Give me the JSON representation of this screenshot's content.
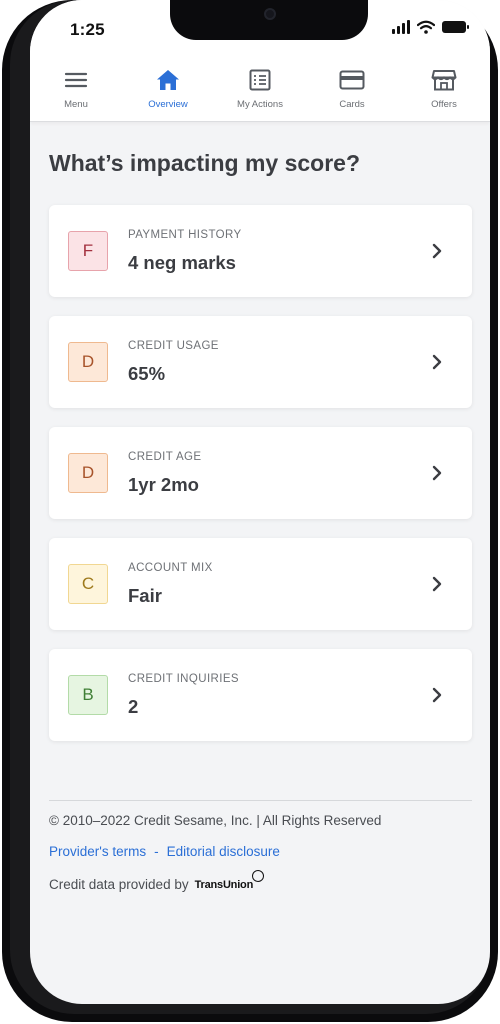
{
  "status_bar": {
    "time": "1:25"
  },
  "nav": {
    "items": [
      {
        "label": "Menu",
        "icon": "hamburger-menu-icon",
        "active": false
      },
      {
        "label": "Overview",
        "icon": "home-icon",
        "active": true
      },
      {
        "label": "My Actions",
        "icon": "checklist-icon",
        "active": false
      },
      {
        "label": "Cards",
        "icon": "credit-card-icon",
        "active": false
      },
      {
        "label": "Offers",
        "icon": "storefront-icon",
        "active": false
      }
    ],
    "active_color": "#2b6fd6"
  },
  "page": {
    "title": "What’s impacting my score?"
  },
  "factors": [
    {
      "grade": "F",
      "label": "PAYMENT HISTORY",
      "value": "4 neg marks",
      "badge_bg": "#fbe3e6",
      "badge_border": "#e7a3ab",
      "badge_color": "#a3313f"
    },
    {
      "grade": "D",
      "label": "CREDIT USAGE",
      "value": "65%",
      "badge_bg": "#fde8d8",
      "badge_border": "#efb98f",
      "badge_color": "#a7532a"
    },
    {
      "grade": "D",
      "label": "CREDIT AGE",
      "value": "1yr 2mo",
      "badge_bg": "#fde8d8",
      "badge_border": "#efb98f",
      "badge_color": "#a7532a"
    },
    {
      "grade": "C",
      "label": "ACCOUNT MIX",
      "value": "Fair",
      "badge_bg": "#fef5dc",
      "badge_border": "#f1d792",
      "badge_color": "#9e7a1c"
    },
    {
      "grade": "B",
      "label": "CREDIT INQUIRIES",
      "value": "2",
      "badge_bg": "#e6f5e1",
      "badge_border": "#b3dba8",
      "badge_color": "#3f7f35"
    }
  ],
  "footer": {
    "copyright": "© 2010–2022 Credit Sesame, Inc. | All Rights Reserved",
    "links": [
      "Provider's terms",
      "Editorial disclosure"
    ],
    "link_separator": "-",
    "credit_data_text": "Credit data provided by",
    "bureau_logo_text": "TransUnion",
    "link_color": "#2b6fd6"
  }
}
